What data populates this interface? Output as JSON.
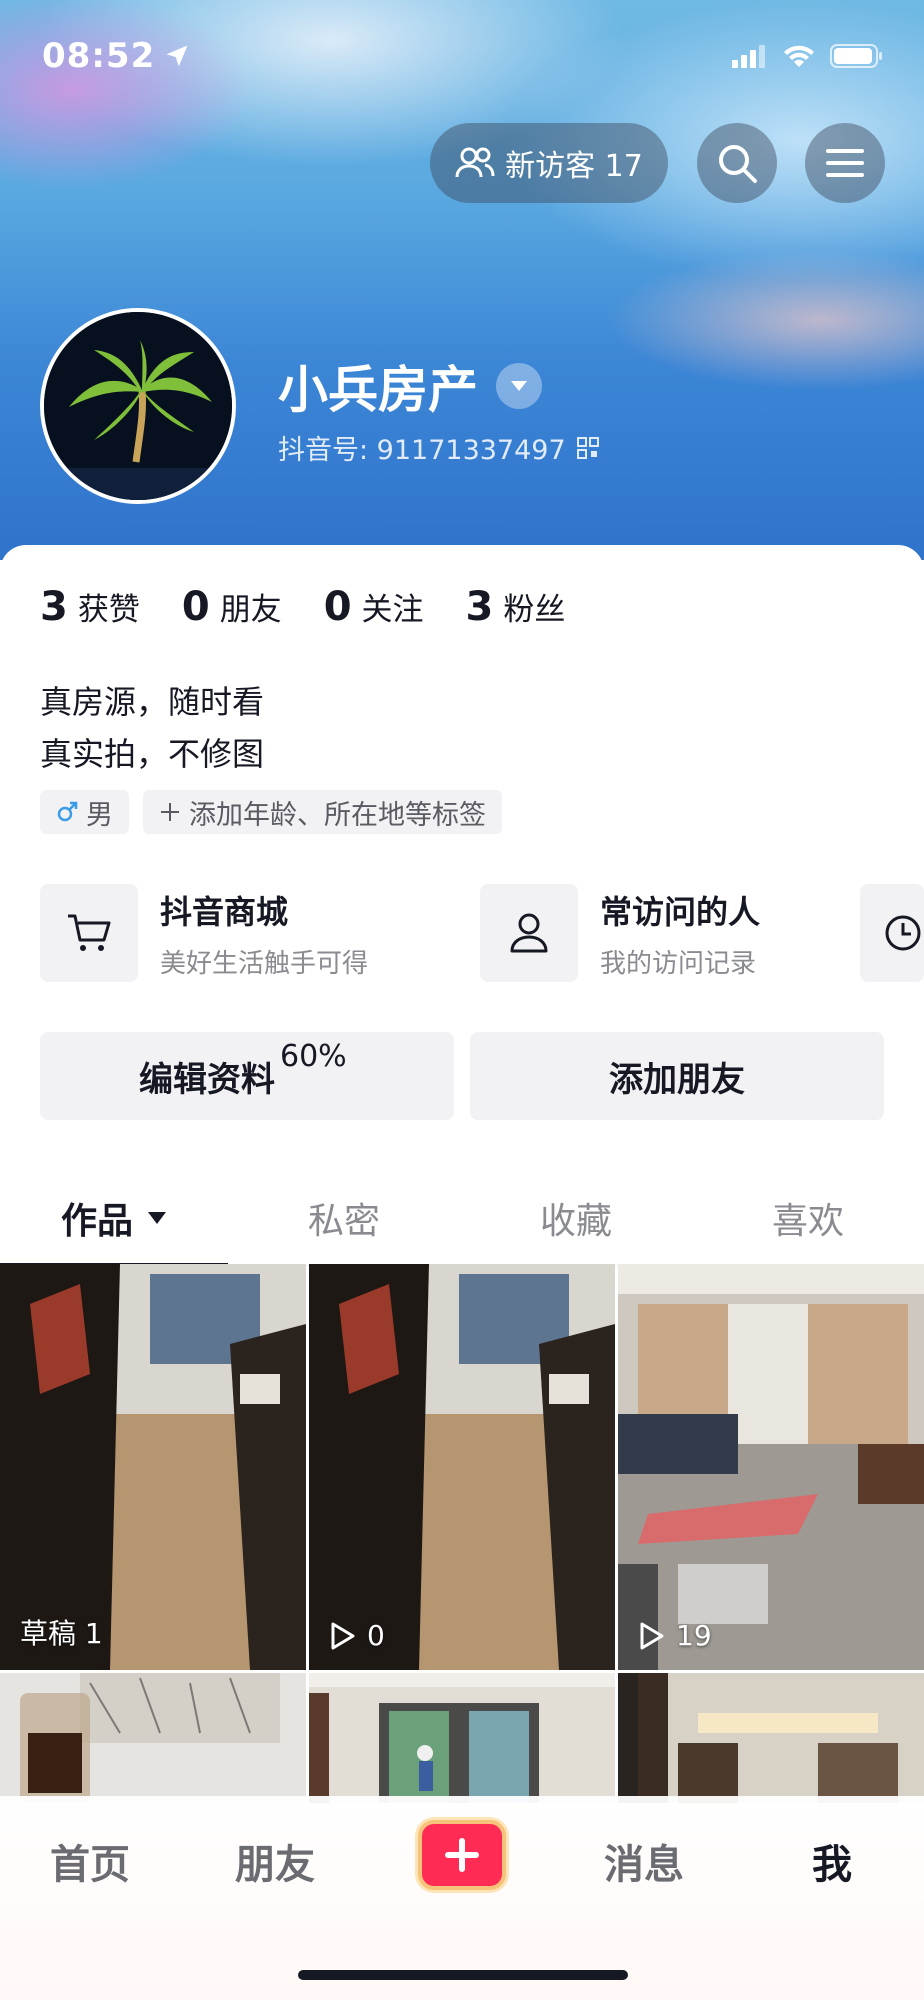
{
  "status": {
    "time": "08:52"
  },
  "header": {
    "visitor_label": "新访客 17"
  },
  "profile": {
    "name": "小兵房产",
    "douyin_id": "抖音号: 91171337497"
  },
  "stats": [
    {
      "num": "3",
      "label": "获赞"
    },
    {
      "num": "0",
      "label": "朋友"
    },
    {
      "num": "0",
      "label": "关注"
    },
    {
      "num": "3",
      "label": "粉丝"
    }
  ],
  "bio": {
    "line1": "真房源，随时看",
    "line2": "真实拍，不修图"
  },
  "tags": {
    "gender": "男",
    "add": "添加年龄、所在地等标签"
  },
  "shortcuts": [
    {
      "title": "抖音商城",
      "sub": "美好生活触手可得",
      "icon": "cart-icon"
    },
    {
      "title": "常访问的人",
      "sub": "我的访问记录",
      "icon": "person-icon"
    }
  ],
  "actions": {
    "edit": "编辑资料",
    "edit_progress": "60%",
    "add_friend": "添加朋友"
  },
  "tabs": [
    {
      "label": "作品"
    },
    {
      "label": "私密"
    },
    {
      "label": "收藏"
    },
    {
      "label": "喜欢"
    }
  ],
  "grid": [
    {
      "caption": "草稿 1"
    },
    {
      "caption": "0"
    },
    {
      "caption": "19"
    }
  ],
  "nav": {
    "home": "首页",
    "friends": "朋友",
    "messages": "消息",
    "me": "我"
  },
  "colors": {
    "accent": "#fe2c55",
    "hero_blue": "#3c86d6"
  }
}
